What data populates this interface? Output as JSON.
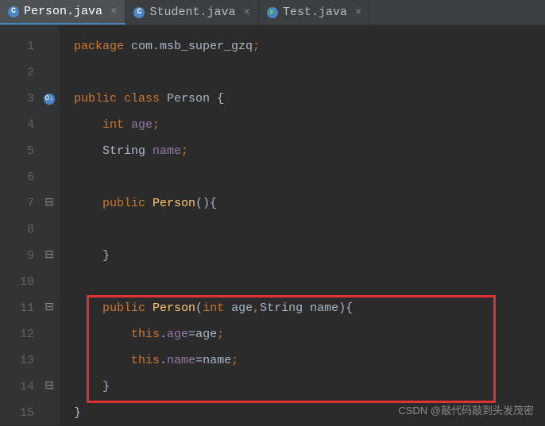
{
  "tabs": [
    {
      "label": "Person.java",
      "active": true,
      "icon": "class"
    },
    {
      "label": "Student.java",
      "active": false,
      "icon": "class"
    },
    {
      "label": "Test.java",
      "active": false,
      "icon": "run"
    }
  ],
  "lines": {
    "count": 15
  },
  "code": {
    "l1_package": "package",
    "l1_pkg": " com.msb_super_gzq",
    "l1_semi": ";",
    "l3_public": "public ",
    "l3_class": "class ",
    "l3_name": "Person ",
    "l3_brace": "{",
    "l4_type": "int ",
    "l4_field": "age",
    "l4_semi": ";",
    "l5_type": "String ",
    "l5_field": "name",
    "l5_semi": ";",
    "l7_public": "public ",
    "l7_method": "Person",
    "l7_paren": "(){",
    "l9_brace": "}",
    "l11_public": "public ",
    "l11_method": "Person",
    "l11_open": "(",
    "l11_t1": "int ",
    "l11_p1": "age",
    "l11_comma": ",",
    "l11_t2": "String ",
    "l11_p2": "name",
    "l11_close": "){",
    "l12_this": "this",
    "l12_dot": ".",
    "l12_field": "age",
    "l12_eq": "=age",
    "l12_semi": ";",
    "l13_this": "this",
    "l13_dot": ".",
    "l13_field": "name",
    "l13_eq": "=name",
    "l13_semi": ";",
    "l14_brace": "}",
    "l15_brace": "}"
  },
  "watermark": "CSDN @敲代码敲到头发茂密"
}
